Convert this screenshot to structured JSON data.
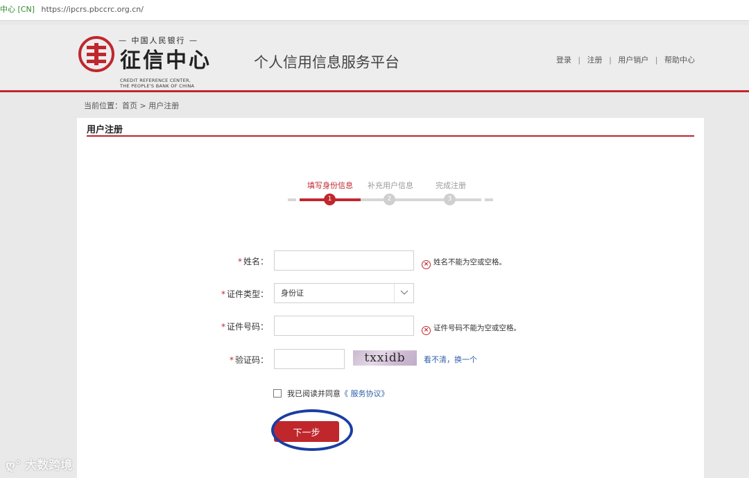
{
  "browser": {
    "cert_label": "中心 [CN]",
    "url": "https://ipcrs.pbccrc.org.cn/"
  },
  "header": {
    "logo_top": "— 中国人民银行 —",
    "logo_main": "征信中心",
    "logo_en_1": "CREDIT REFERENCE CENTER,",
    "logo_en_2": "THE PEOPLE'S BANK OF CHINA",
    "platform_title": "个人信用信息服务平台",
    "nav": [
      {
        "label": "登录"
      },
      {
        "label": "注册"
      },
      {
        "label": "用户销户"
      },
      {
        "label": "帮助中心"
      }
    ],
    "nav_sep": "|"
  },
  "breadcrumb": "当前位置：首页 > 用户注册",
  "card": {
    "title": "用户注册"
  },
  "steps": [
    {
      "label": "填写身份信息",
      "number": "1",
      "active": true
    },
    {
      "label": "补充用户信息",
      "number": "2",
      "active": false
    },
    {
      "label": "完成注册",
      "number": "3",
      "active": false
    }
  ],
  "form": {
    "required_mark": "*",
    "name": {
      "label": "姓名：",
      "value": "",
      "error": "姓名不能为空或空格。"
    },
    "id_type": {
      "label": "证件类型：",
      "value": "身份证"
    },
    "id_number": {
      "label": "证件号码：",
      "value": "",
      "error": "证件号码不能为空或空格。"
    },
    "captcha": {
      "label": "验证码：",
      "value": "",
      "image_text": "txxidb",
      "refresh_label": "看不清，换一个"
    },
    "agree": {
      "text": "我已阅读并同意",
      "link": "《 服务协议》"
    },
    "next_label": "下一步"
  },
  "error_icon": "⊗",
  "watermark": "大数跨境",
  "colors": {
    "brand_red": "#c0272d",
    "link_blue": "#2f5fa8",
    "annotation_blue": "#1a3ea1"
  }
}
